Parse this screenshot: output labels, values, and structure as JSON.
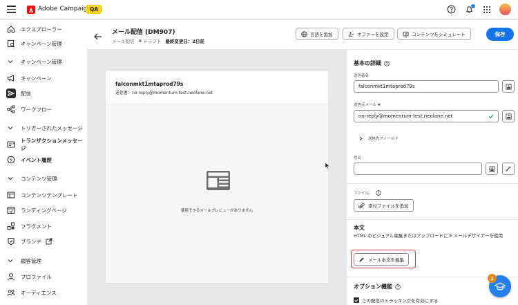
{
  "topbar": {
    "app_name": "Adobe Campaign",
    "env_badge": "QA"
  },
  "sidebar": {
    "items": [
      {
        "label": "エクスプローラー",
        "icon": "home-icon"
      },
      {
        "label": "キャンペーン管理",
        "icon": "search-list-icon"
      },
      {
        "label": "キャンペーン管理",
        "icon": "chevron-down-icon",
        "section": true
      },
      {
        "label": "キャンペーン",
        "icon": "megaphone-icon"
      },
      {
        "label": "配信",
        "icon": "send-icon",
        "active": true
      },
      {
        "label": "ワークフロー",
        "icon": "workflow-icon"
      },
      {
        "label": "トリガーされたメッセージ",
        "icon": "chevron-down-icon",
        "section": true
      },
      {
        "label": "トランザクションメッセージ",
        "icon": "transaction-icon",
        "bold": true
      },
      {
        "label": "イベント履歴",
        "icon": "event-icon",
        "bold": true
      },
      {
        "label": "コンテンツ管理",
        "icon": "chevron-down-icon",
        "section": true
      },
      {
        "label": "コンテンツテンプレート",
        "icon": "template-icon"
      },
      {
        "label": "ランディングページ",
        "icon": "landing-page-icon"
      },
      {
        "label": "フラグメント",
        "icon": "fragment-icon"
      },
      {
        "label": "ブランド",
        "icon": "brand-icon",
        "extra_icon": "open-external-icon"
      },
      {
        "label": "顧客管理",
        "icon": "chevron-down-icon",
        "section": true
      },
      {
        "label": "プロファイル",
        "icon": "profile-icon"
      },
      {
        "label": "オーディエンス",
        "icon": "audience-icon"
      }
    ]
  },
  "header": {
    "title": "メール配信 (DM907)",
    "type": "メール配信",
    "status": "ドラフト",
    "last_modified_label": "最終変更日：",
    "last_modified_value": "2日前",
    "buttons": {
      "add_language": "言語を追加",
      "offer_settings": "オファーを設定",
      "simulate_content": "コンテンツをシミュレート",
      "save": "保存"
    }
  },
  "preview": {
    "sender_name": "falconmkt1mtaprod79s",
    "sender_address": "送信者：no-reply@momentum-test.neolane.net",
    "empty_message": "使用できるメールプレビューがありません"
  },
  "panel": {
    "basic": {
      "title": "基本の詳細",
      "sender_name_label": "送信者名",
      "sender_name_value": "falconmkt1mtaprod79s",
      "sender_email_label": "送信元メール",
      "sender_email_value": "no-reply@momentum-test.neolane.net",
      "accordion_label": "送信先フィールド",
      "subject_label": "件名",
      "subject_value": ""
    },
    "files": {
      "label": "ファイル：",
      "add_attachment": "添付ファイルを追加"
    },
    "body": {
      "title": "本文",
      "description": "HTML のビジュアル編集またはアップロードに E メールデザイナーを使用",
      "edit_button": "メール本文を編集"
    },
    "options": {
      "title": "オプション機能",
      "tracking_label": "この配信のトラッキングを有効にする"
    }
  },
  "fab": {
    "badge": "1"
  }
}
